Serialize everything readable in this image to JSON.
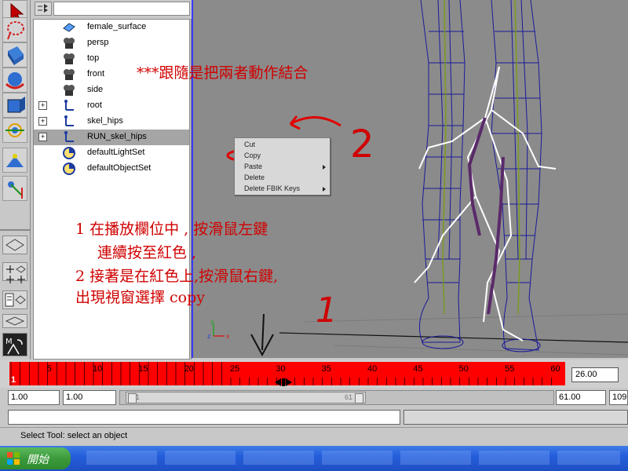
{
  "outliner": {
    "items": [
      {
        "label": "female_surface",
        "icon": "surface-icon",
        "expandable": false,
        "selected": false
      },
      {
        "label": "persp",
        "icon": "camera-icon",
        "expandable": false,
        "selected": false
      },
      {
        "label": "top",
        "icon": "camera-icon",
        "expandable": false,
        "selected": false
      },
      {
        "label": "front",
        "icon": "camera-icon",
        "expandable": false,
        "selected": false
      },
      {
        "label": "side",
        "icon": "camera-icon",
        "expandable": false,
        "selected": false
      },
      {
        "label": "root",
        "icon": "joint-icon",
        "expandable": true,
        "selected": false
      },
      {
        "label": "skel_hips",
        "icon": "joint-icon",
        "expandable": true,
        "selected": false
      },
      {
        "label": "RUN_skel_hips",
        "icon": "joint-icon",
        "expandable": true,
        "selected": true
      },
      {
        "label": "defaultLightSet",
        "icon": "set-icon",
        "expandable": false,
        "selected": false
      },
      {
        "label": "defaultObjectSet",
        "icon": "set-icon",
        "expandable": false,
        "selected": false
      }
    ]
  },
  "context_menu": {
    "items": [
      {
        "label": "Cut",
        "submenu": false
      },
      {
        "label": "Copy",
        "submenu": false
      },
      {
        "label": "Paste",
        "submenu": true
      },
      {
        "label": "Delete",
        "submenu": false
      },
      {
        "label": "Delete FBIK Keys",
        "submenu": true
      }
    ]
  },
  "annotations": {
    "top_note": "***跟隨是把兩者動作結合",
    "step1_line1": "1  在播放欄位中  ,  按滑鼠左鍵",
    "step1_line2": "連續按至紅色 ,",
    "step2_line1": "2   接著是在紅色上,按滑鼠右鍵,",
    "step2_line2": "出現視窗選擇 copy",
    "big_one": "1",
    "big_two": "2"
  },
  "timeline": {
    "ticks": [
      "5",
      "10",
      "15",
      "20",
      "25",
      "30",
      "35",
      "40",
      "45",
      "50",
      "55",
      "60"
    ],
    "start_label": "1",
    "current_time": "26.00",
    "key_color": "#ff0000"
  },
  "range": {
    "start": "1.00",
    "playback_start": "1.00",
    "slider_left": "1",
    "slider_right": "61",
    "playback_end": "61.00",
    "end": "109"
  },
  "help_line": "Select Tool: select an object",
  "taskbar": {
    "start_label": "開始"
  },
  "colors": {
    "annotation": "#d00000",
    "viewport_border": "#3b3bff",
    "timeline_keys": "#ff0000"
  }
}
